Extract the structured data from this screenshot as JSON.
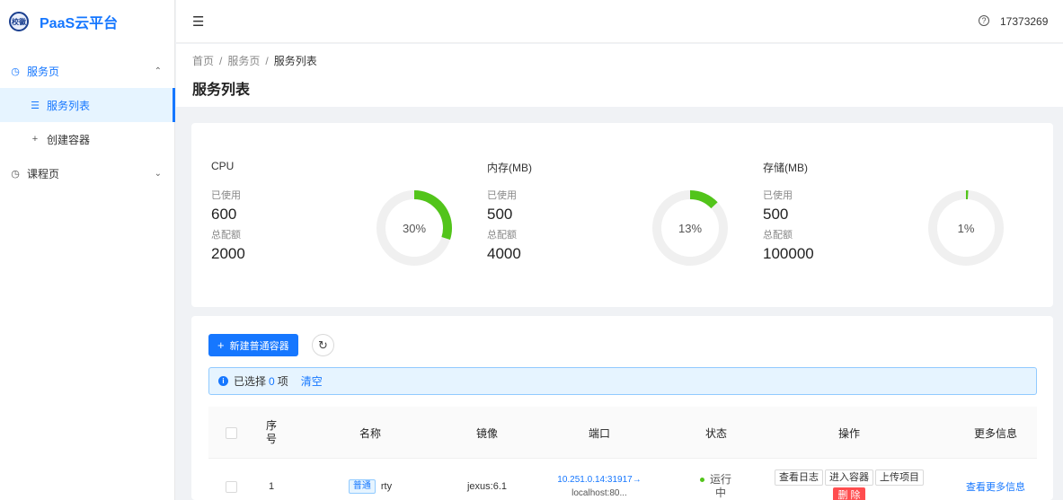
{
  "app": {
    "title": "PaaS云平台",
    "logo_text": "校徽"
  },
  "user": {
    "name": "17373269"
  },
  "sidebar": {
    "items": [
      {
        "label": "服务页",
        "icon": "dashboard-icon",
        "caret": "⌃"
      },
      {
        "label": "服务列表",
        "icon": "list-icon"
      },
      {
        "label": "创建容器",
        "icon": "plus-icon"
      },
      {
        "label": "课程页",
        "icon": "dashboard-icon",
        "caret": "⌄"
      }
    ]
  },
  "breadcrumb": [
    "首页",
    "服务页",
    "服务列表"
  ],
  "page": {
    "title": "服务列表"
  },
  "stats": [
    {
      "label": "CPU",
      "used_label": "已使用",
      "used": "600",
      "quota_label": "总配额",
      "quota": "2000",
      "percent_text": "30%",
      "percent": 30
    },
    {
      "label": "内存(MB)",
      "used_label": "已使用",
      "used": "500",
      "quota_label": "总配额",
      "quota": "4000",
      "percent_text": "13%",
      "percent": 13
    },
    {
      "label": "存储(MB)",
      "used_label": "已使用",
      "used": "500",
      "quota_label": "总配额",
      "quota": "100000",
      "percent_text": "1%",
      "percent": 1
    }
  ],
  "toolbar": {
    "new_label": "新建普通容器"
  },
  "selection": {
    "prefix": "已选择",
    "count": "0",
    "suffix": "项",
    "clear": "清空"
  },
  "table": {
    "headers": [
      "序\n号",
      "名称",
      "镜像",
      "端口",
      "状态",
      "操作",
      "更多信息"
    ],
    "rows": [
      {
        "index": "1",
        "tag": "普通",
        "name": "rty",
        "image": "jexus:6.1",
        "port_line1": "10.251.0.14:31917→",
        "port_line2": "localhost:80...",
        "status": "运行中",
        "actions": [
          "查看日志",
          "进入容器",
          "上传项目",
          "删 除"
        ],
        "more": "查看更多信息"
      }
    ]
  },
  "colors": {
    "primary": "#1677ff",
    "ring_fill": "#52c41a",
    "ring_track": "#f0f0f0",
    "danger": "#ff4d4f"
  }
}
